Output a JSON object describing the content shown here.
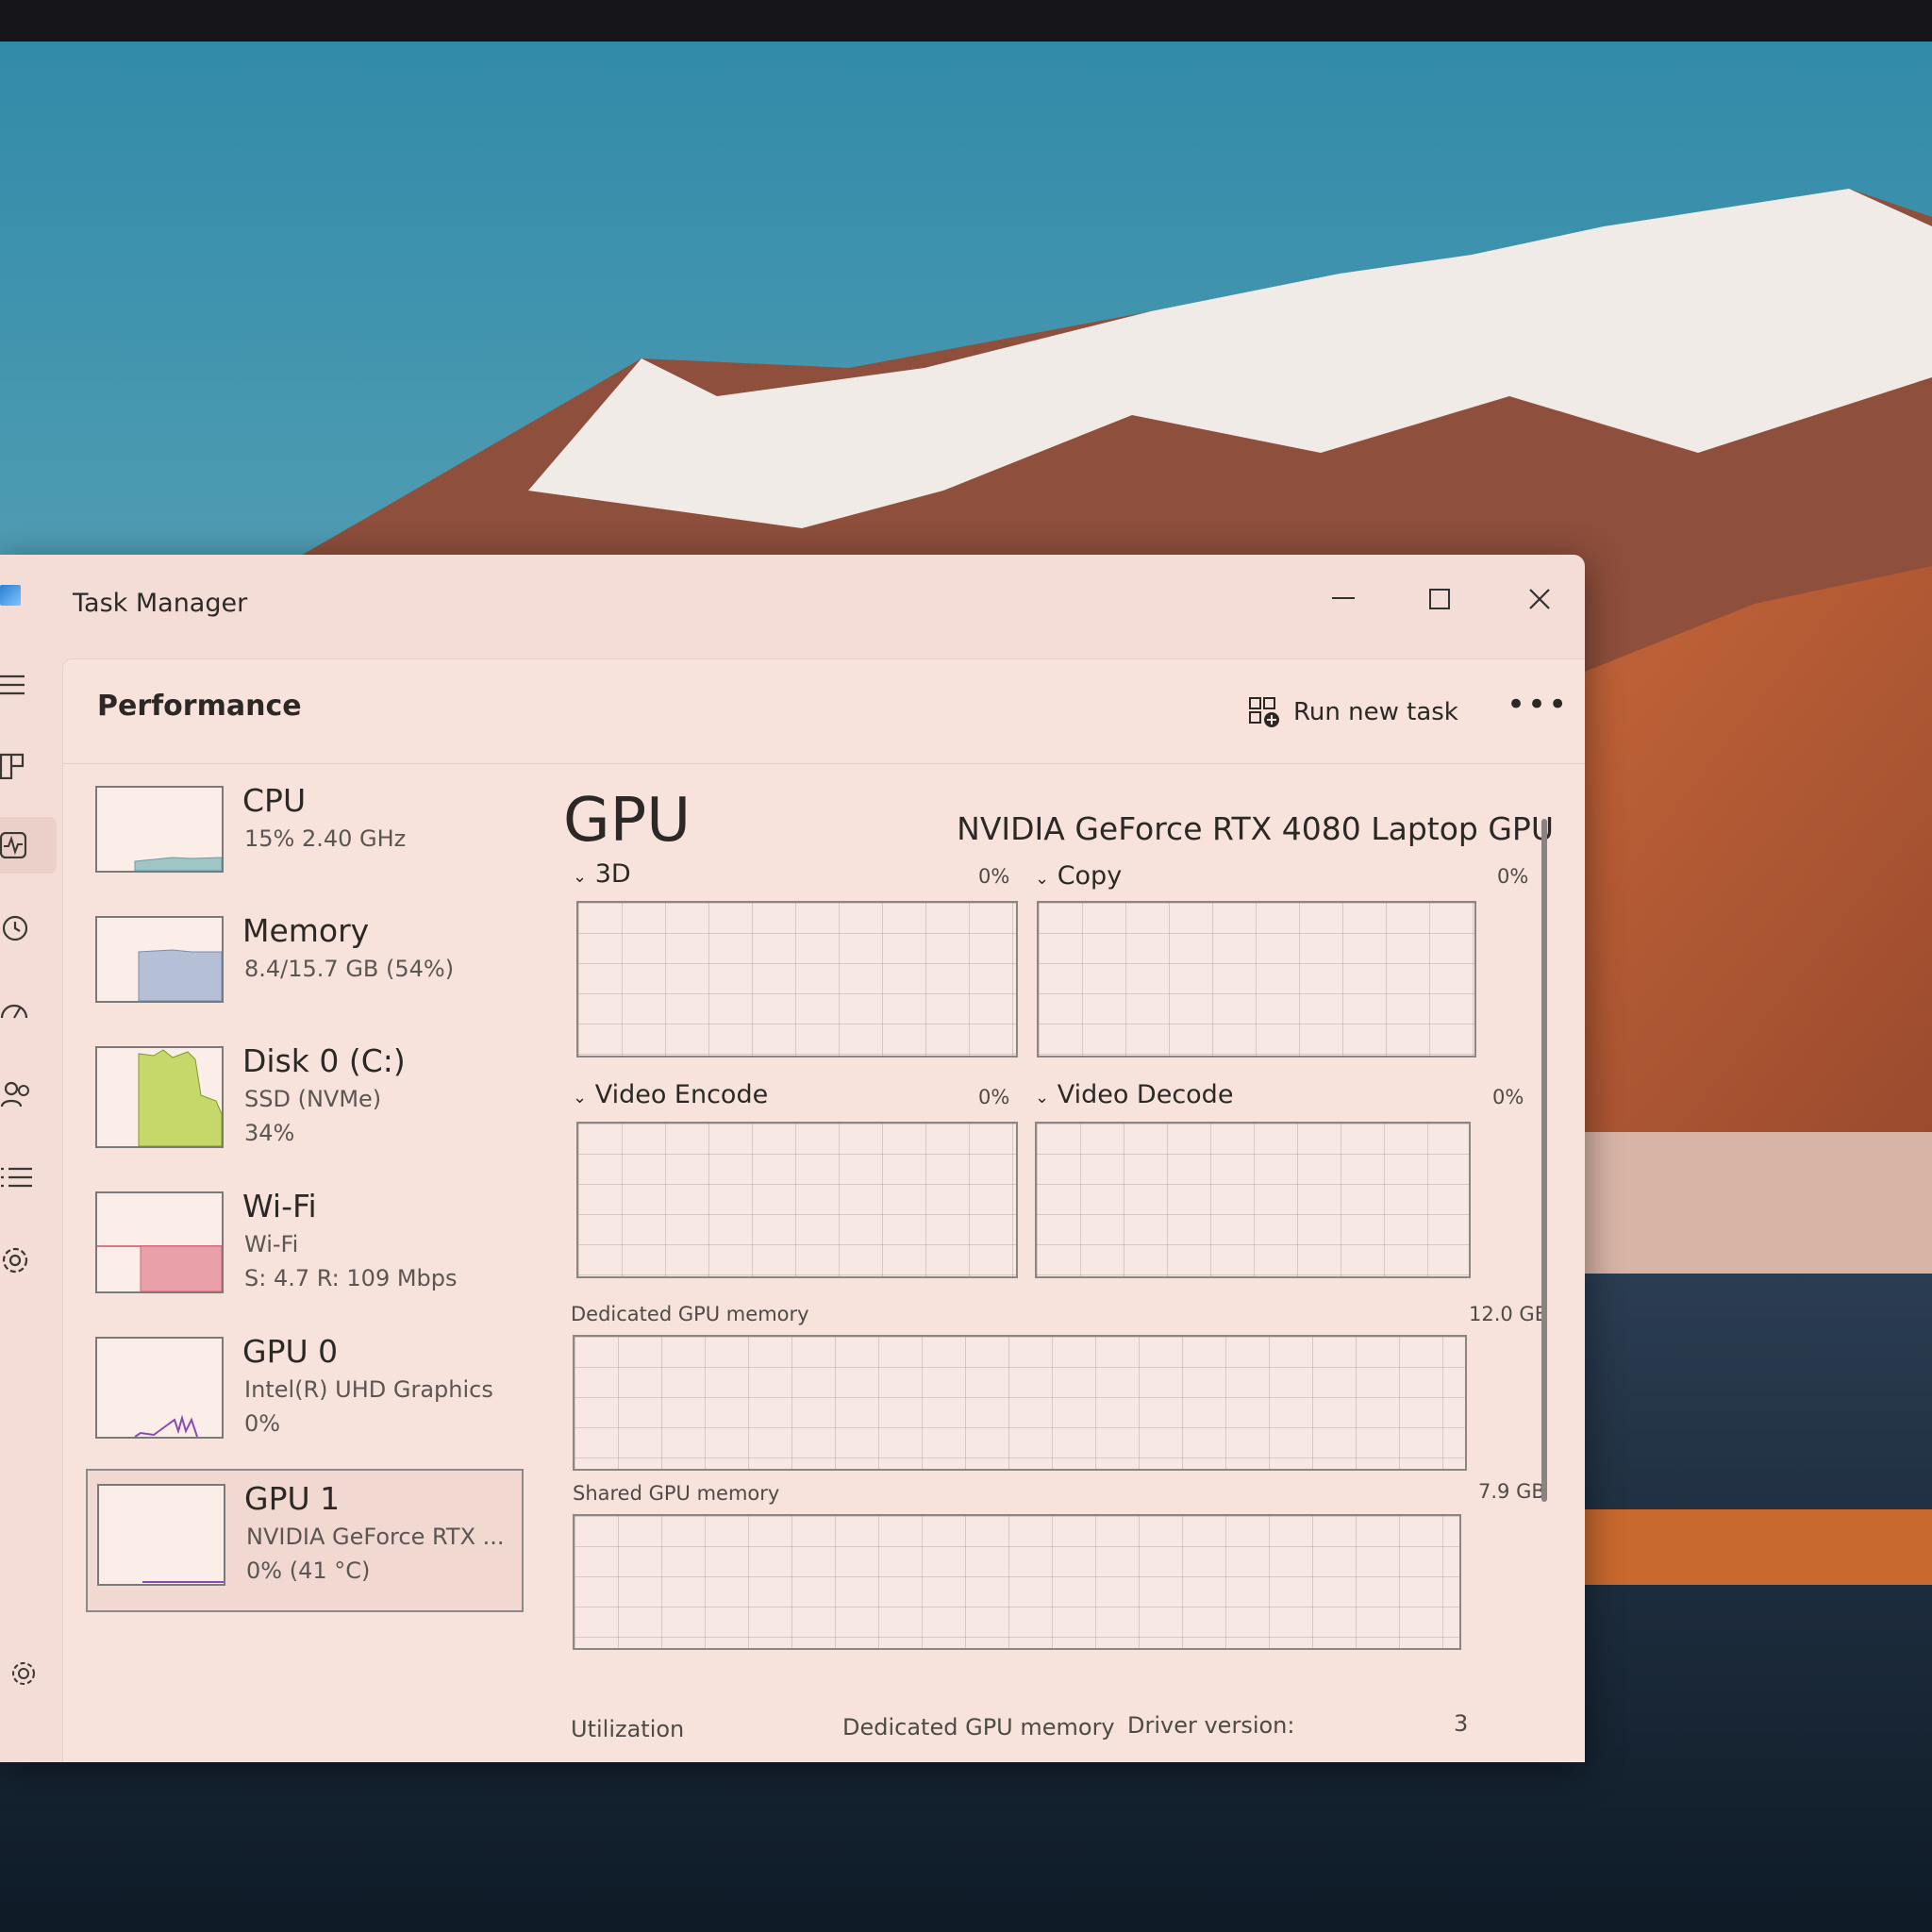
{
  "window": {
    "title": "Task Manager"
  },
  "header": {
    "title": "Performance",
    "run_new_task": "Run new task",
    "more": "•••"
  },
  "sidebar_items": [
    {
      "name": "CPU",
      "line1": "15%  2.40 GHz",
      "line2": ""
    },
    {
      "name": "Memory",
      "line1": "8.4/15.7 GB (54%)",
      "line2": ""
    },
    {
      "name": "Disk 0 (C:)",
      "line1": "SSD (NVMe)",
      "line2": "34%"
    },
    {
      "name": "Wi-Fi",
      "line1": "Wi-Fi",
      "line2": "S: 4.7  R: 109 Mbps"
    },
    {
      "name": "GPU 0",
      "line1": "Intel(R) UHD Graphics",
      "line2": "0%"
    },
    {
      "name": "GPU 1",
      "line1": "NVIDIA GeForce RTX ...",
      "line2": "0%  (41 °C)"
    }
  ],
  "gpu": {
    "title": "GPU",
    "model": "NVIDIA GeForce RTX 4080 Laptop GPU",
    "engines": [
      {
        "label": "3D",
        "value": "0%"
      },
      {
        "label": "Copy",
        "value": "0%"
      },
      {
        "label": "Video Encode",
        "value": "0%"
      },
      {
        "label": "Video Decode",
        "value": "0%"
      }
    ],
    "dedicated_label": "Dedicated GPU memory",
    "dedicated_max": "12.0 GB",
    "shared_label": "Shared GPU memory",
    "shared_max": "7.9 GB",
    "bottom": {
      "utilization": "Utilization",
      "dedicated": "Dedicated GPU memory",
      "driver": "Driver version:",
      "driver_val": "3"
    }
  }
}
